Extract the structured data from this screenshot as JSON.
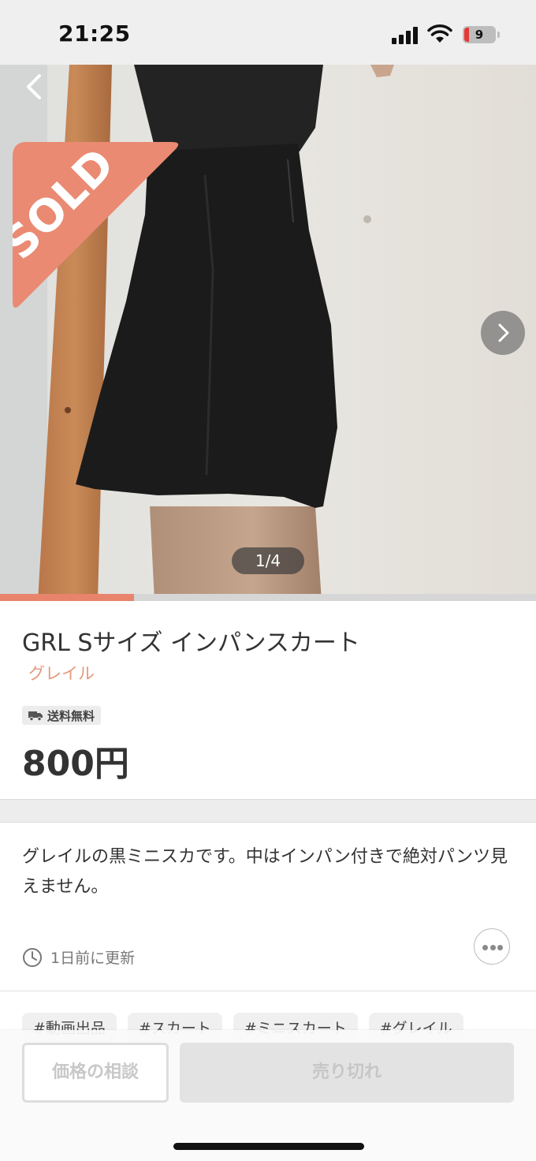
{
  "status_bar": {
    "time": "21:25",
    "battery_level": "9",
    "icons": [
      "signal-icon",
      "wifi-icon",
      "battery-icon"
    ]
  },
  "gallery": {
    "sold_label": "SOLD",
    "counter": "1/4",
    "current": 1,
    "total": 4,
    "back_icon": "chevron-left-icon",
    "next_icon": "chevron-right-icon"
  },
  "item": {
    "title": "GRL Sサイズ インパンスカート",
    "brand": "グレイル",
    "shipping": "送料無料",
    "price": "800円",
    "description": "グレイルの黒ミニスカです。中はインパン付きで絶対パンツ見えません。",
    "updated": "1日前に更新"
  },
  "tags": [
    "#動画出品",
    "#スカート",
    "#ミニスカート",
    "#グレイル"
  ],
  "actions": {
    "negotiate": "価格の相談",
    "sold_out": "売り切れ"
  },
  "colors": {
    "accent": "#e9846c",
    "brand_text": "#e39a7d",
    "sold_banner": "#ea8a72"
  }
}
